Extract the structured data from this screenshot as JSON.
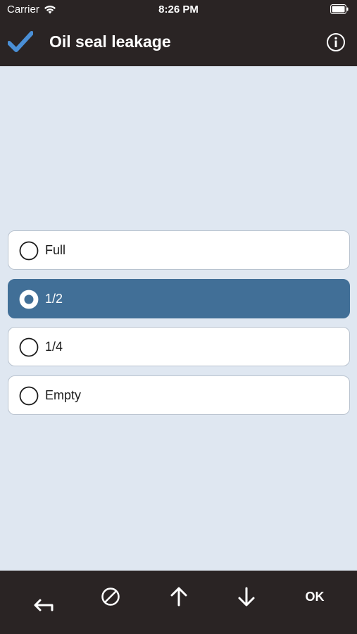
{
  "status_bar": {
    "carrier": "Carrier",
    "time": "8:26 PM"
  },
  "nav": {
    "title": "Oil seal leakage",
    "check_icon": "checkmark-icon",
    "info_icon": "info-icon"
  },
  "options": [
    {
      "label": "Full",
      "selected": false
    },
    {
      "label": "1/2",
      "selected": true
    },
    {
      "label": "1/4",
      "selected": false
    },
    {
      "label": "Empty",
      "selected": false
    }
  ],
  "toolbar": {
    "back_icon": "return-arrow-icon",
    "clear_icon": "prohibited-icon",
    "up_icon": "arrow-up-icon",
    "down_icon": "arrow-down-icon",
    "ok_label": "OK"
  },
  "colors": {
    "bar_background": "#2a2424",
    "content_background": "#dfe7f1",
    "selected_background": "#416f97",
    "check_accent": "#4a8fd6"
  }
}
